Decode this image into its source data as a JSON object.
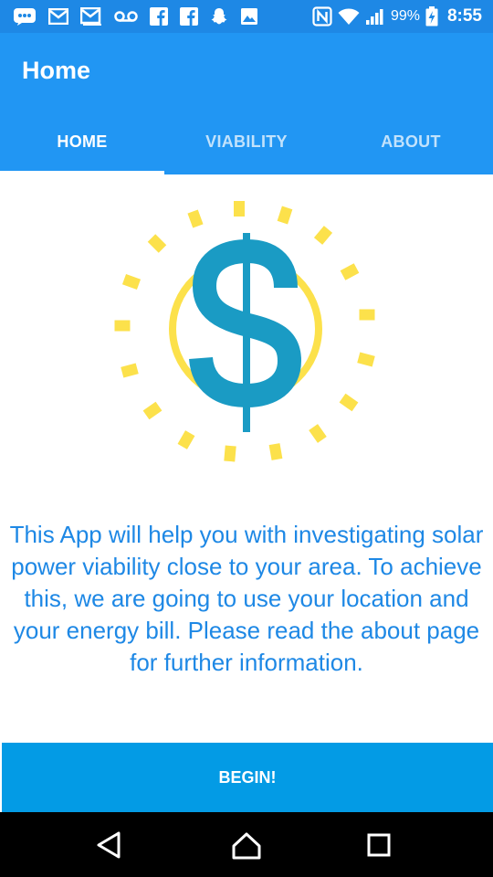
{
  "status_bar": {
    "notification_icons": [
      "message-icon",
      "gmail-icon",
      "gmail-icon",
      "voicemail-icon",
      "facebook-icon",
      "facebook-icon",
      "snapchat-icon",
      "gallery-icon"
    ],
    "status_icons": [
      "nfc-icon",
      "wifi-icon",
      "signal-icon",
      "battery-icon"
    ],
    "battery": "99%",
    "time": "8:55"
  },
  "app_bar": {
    "title": "Home"
  },
  "tabs": [
    {
      "label": "HOME",
      "selected": true
    },
    {
      "label": "VIABILITY",
      "selected": false
    },
    {
      "label": "ABOUT",
      "selected": false
    }
  ],
  "logo": {
    "icon": "solar-dollar-logo",
    "colors": {
      "sun": "#FCE14B",
      "dollar": "#1A9BC4"
    }
  },
  "main": {
    "description": "This App will help you with investigating solar power viability close to your area. To achieve this, we are going to use your location and your energy bill. Please read the about page for further information.",
    "begin_label": "BEGIN!"
  },
  "nav_bar": {
    "buttons": [
      "back-icon",
      "home-icon",
      "recents-icon"
    ]
  },
  "colors": {
    "status_bar": "#1E88E5",
    "primary": "#2196F3",
    "accent_button": "#039BE5",
    "text_blue": "#1E88E5"
  }
}
